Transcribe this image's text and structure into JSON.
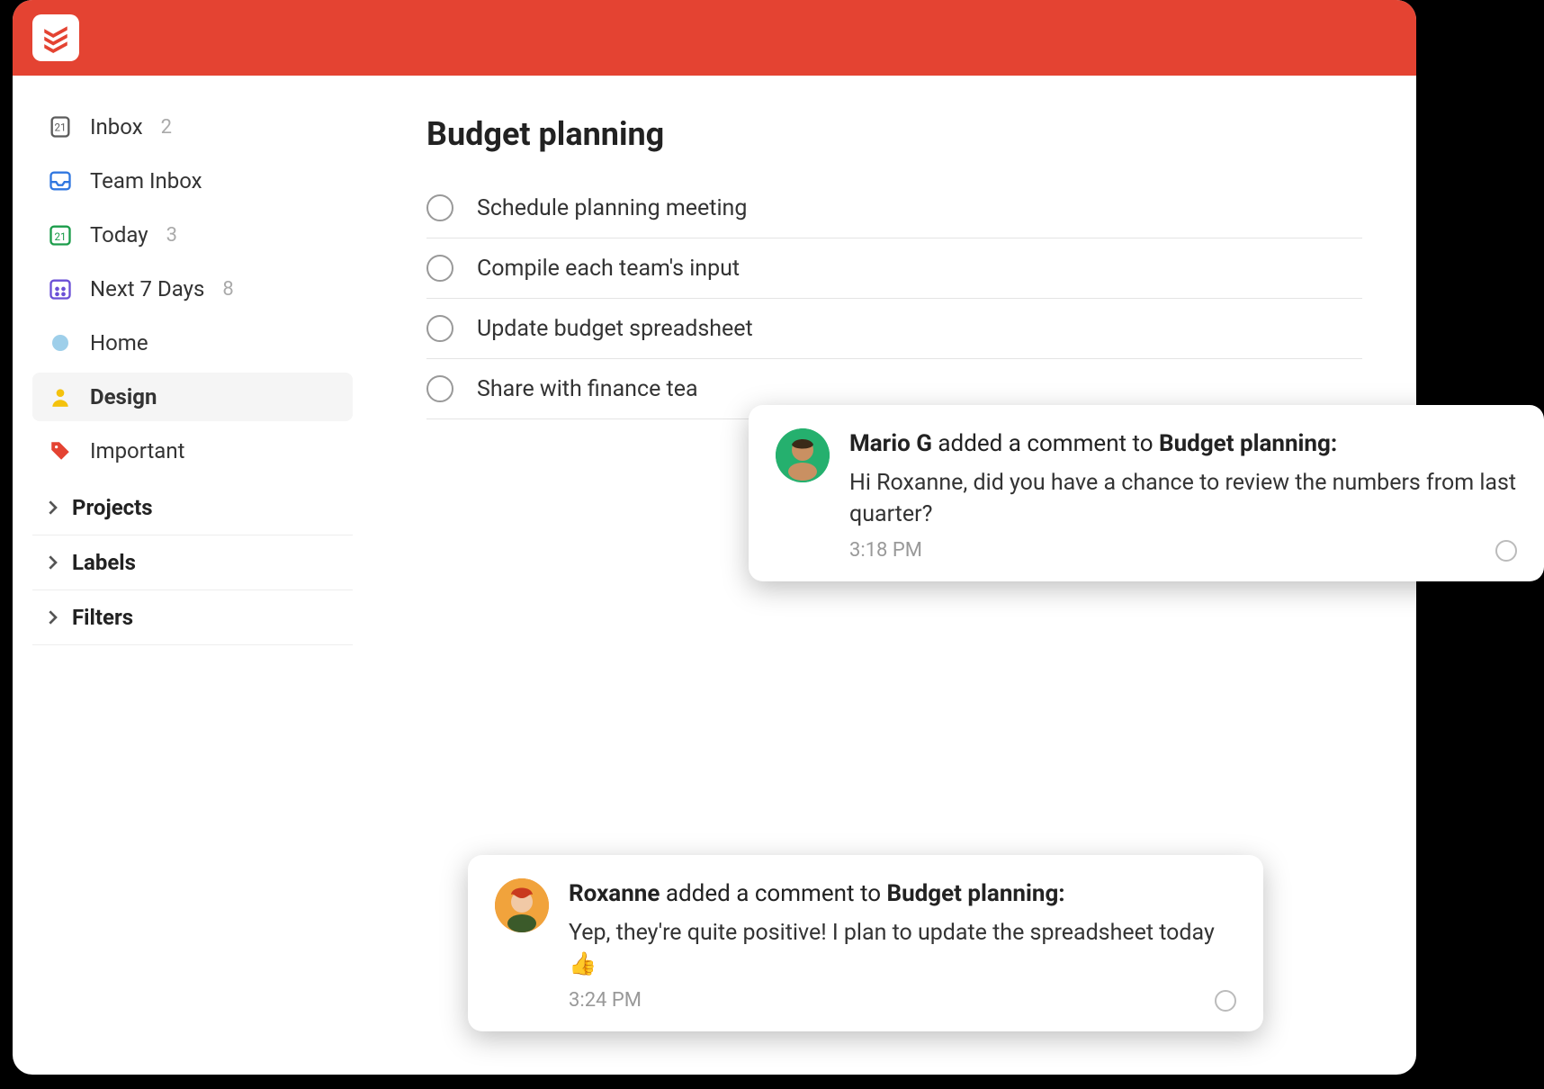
{
  "sidebar": {
    "items": [
      {
        "label": "Inbox",
        "count": "2"
      },
      {
        "label": "Team Inbox",
        "count": ""
      },
      {
        "label": "Today",
        "count": "3"
      },
      {
        "label": "Next 7 Days",
        "count": "8"
      },
      {
        "label": "Home",
        "count": ""
      },
      {
        "label": "Design",
        "count": ""
      },
      {
        "label": "Important",
        "count": ""
      }
    ],
    "sections": [
      {
        "label": "Projects"
      },
      {
        "label": "Labels"
      },
      {
        "label": "Filters"
      }
    ]
  },
  "main": {
    "title": "Budget planning",
    "tasks": [
      {
        "label": "Schedule planning meeting"
      },
      {
        "label": "Compile each team's input"
      },
      {
        "label": "Update budget spreadsheet"
      },
      {
        "label": "Share with finance tea"
      }
    ]
  },
  "notifications": [
    {
      "author": "Mario G",
      "verb_prefix": " added a comment to ",
      "target": "Budget planning:",
      "message": "Hi Roxanne, did you have a chance to review the numbers from last quarter?",
      "time": "3:18 PM"
    },
    {
      "author": "Roxanne",
      "verb_prefix": " added a comment to ",
      "target": "Budget planning:",
      "message": "Yep, they're quite positive! I plan to update the spreadsheet today 👍",
      "time": "3:24 PM"
    }
  ],
  "icons": {
    "calendar_day": "21"
  }
}
